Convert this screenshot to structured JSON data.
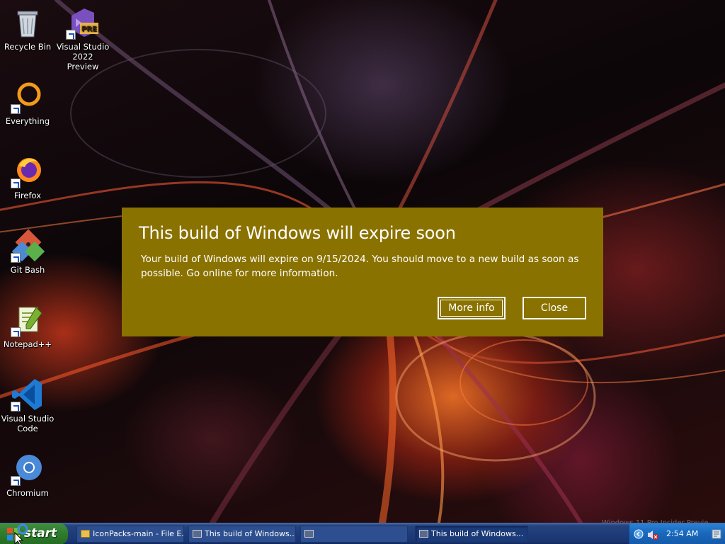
{
  "desktop": {
    "icons": [
      {
        "label": "Recycle Bin",
        "icon": "recycle-bin-icon"
      },
      {
        "label": "Visual Studio 2022 Preview",
        "icon": "visual-studio-preview-icon",
        "badge": "PRE"
      },
      {
        "label": "Everything",
        "icon": "everything-search-icon"
      },
      {
        "label": "Firefox",
        "icon": "firefox-icon"
      },
      {
        "label": "Git Bash",
        "icon": "git-bash-icon"
      },
      {
        "label": "Notepad++",
        "icon": "notepad-plus-plus-icon"
      },
      {
        "label": "Visual Studio Code",
        "icon": "vscode-icon"
      },
      {
        "label": "Chromium",
        "icon": "chromium-icon"
      }
    ]
  },
  "dialog": {
    "title": "This build of Windows will expire soon",
    "body": "Your build of Windows will expire on 9/15/2024. You should move to a new build as soon as possible. Go online for more information.",
    "more_info_label": "More info",
    "close_label": "Close",
    "background_color": "#8a7200"
  },
  "taskbar": {
    "start_label": "start",
    "tasks": [
      {
        "label": "IconPacks-main - File E...",
        "icon": "folder-icon"
      },
      {
        "label": "This build of Windows...",
        "icon": "window-icon"
      },
      {
        "label": "",
        "icon": "window-icon"
      },
      {
        "label": "This build of Windows...",
        "icon": "window-icon"
      }
    ],
    "clock": "2:54 AM"
  },
  "watermark": "Windows 11 Pro Insider Previe"
}
